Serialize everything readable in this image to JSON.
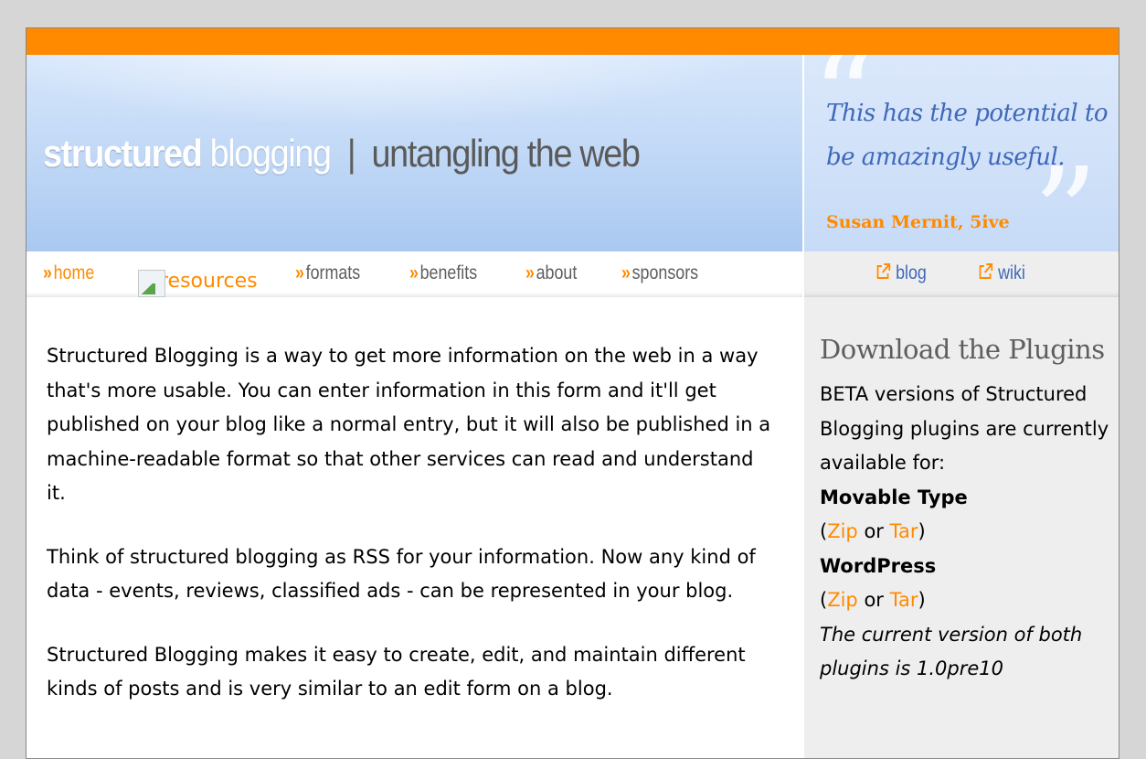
{
  "header": {
    "logo": {
      "strong": "structured",
      "light": "blogging",
      "separator": "|",
      "tagline": "untangling the web"
    },
    "quote": {
      "text": "This has the potential to be amazingly useful.",
      "author": "Susan Mernit, 5ive"
    }
  },
  "nav": {
    "items": [
      {
        "label": "home"
      },
      {
        "label": "resources"
      },
      {
        "label": "formats"
      },
      {
        "label": "benefits"
      },
      {
        "label": "about"
      },
      {
        "label": "sponsors"
      }
    ],
    "chevron": "»",
    "external": [
      {
        "label": "blog"
      },
      {
        "label": "wiki"
      }
    ]
  },
  "main": {
    "paragraphs": [
      "Structured Blogging is a way to get more information on the web in a way that's more usable. You can enter information in this form and it'll get published on your blog like a normal entry, but it will also be published in a machine-readable format so that other services can read and understand it.",
      "Think of structured blogging as RSS for your information. Now any kind of data - events, reviews, classified ads - can be represented in your blog.",
      "Structured Blogging makes it easy to create, edit, and maintain different kinds of posts and is very similar to an edit form on a blog."
    ]
  },
  "sidebar": {
    "title": "Download the Plugins",
    "intro": "BETA versions of Structured Blogging plugins are currently available for:",
    "platforms": [
      {
        "name": "Movable Type",
        "zip": "Zip",
        "or": "or",
        "tar": "Tar"
      },
      {
        "name": "WordPress",
        "zip": "Zip",
        "or": "or",
        "tar": "Tar"
      }
    ],
    "version_note": "The current version of both plugins is 1.0pre10"
  },
  "colors": {
    "accent": "#ff8a00",
    "link_blue": "#3f69b9",
    "banner_blue": "#c7dbf7",
    "sidebar_bg": "#eeeeee"
  }
}
